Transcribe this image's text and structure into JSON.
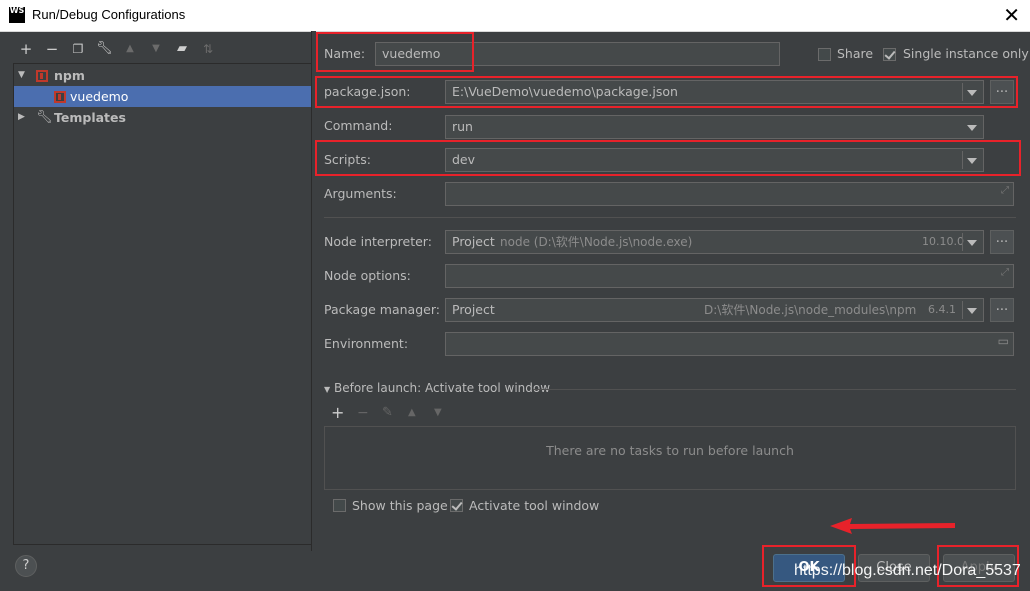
{
  "window": {
    "title": "Run/Debug Configurations",
    "app_icon": "WS"
  },
  "toolbar": {
    "icons": [
      "add-icon",
      "remove-icon",
      "copy-icon",
      "wrench-icon",
      "arrow-up-icon",
      "arrow-down-icon",
      "folder-add-icon",
      "sort-icon"
    ]
  },
  "tree": {
    "npm_label": "npm",
    "vuedemo_label": "vuedemo",
    "templates_label": "Templates"
  },
  "form": {
    "name_label": "Name:",
    "name_value": "vuedemo",
    "share_label": "Share",
    "single_instance_label": "Single instance only",
    "package_json_label": "package.json:",
    "package_json_value": "E:\\VueDemo\\vuedemo\\package.json",
    "command_label": "Command:",
    "command_value": "run",
    "scripts_label": "Scripts:",
    "scripts_value": "dev",
    "arguments_label": "Arguments:",
    "node_interpreter_label": "Node interpreter:",
    "node_interpreter_project": "Project",
    "node_interpreter_path": "node (D:\\软件\\Node.js\\node.exe)",
    "node_interpreter_version": "10.10.0",
    "node_options_label": "Node options:",
    "package_manager_label": "Package manager:",
    "package_manager_project": "Project",
    "package_manager_path": "D:\\软件\\Node.js\\node_modules\\npm",
    "package_manager_version": "6.4.1",
    "environment_label": "Environment:",
    "dots": "..."
  },
  "before_launch": {
    "header": "Before launch: Activate tool window",
    "empty_text": "There are no tasks to run before launch",
    "show_page_label": "Show this page",
    "activate_tool_label": "Activate tool window"
  },
  "buttons": {
    "ok": "OK",
    "close": "Close",
    "apply": "Apply",
    "help": "?"
  },
  "watermark": "https://blog.csdn.net/Dora_5537",
  "checkbox_state": {
    "share": false,
    "single_instance": true,
    "show_page": false,
    "activate_tool": true
  },
  "colors": {
    "highlight": "#e8222a",
    "selection": "#4b6eaf",
    "background": "#3c3f41"
  }
}
